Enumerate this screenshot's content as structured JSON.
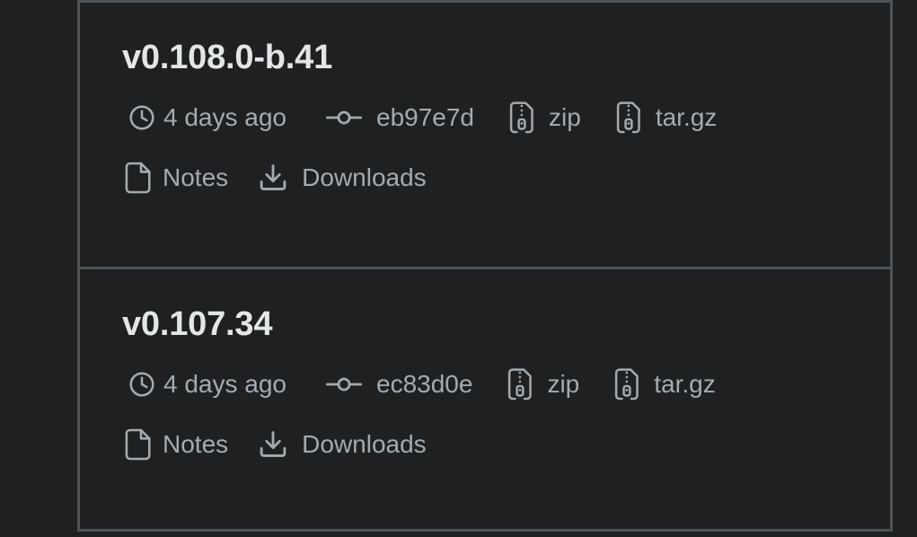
{
  "panel": {
    "name": "releases-list",
    "border_color": "#4d5356",
    "background": "#1f2021",
    "title_color": "#e3e6e8",
    "meta_color": "#a3abb0"
  },
  "releases": [
    {
      "version": "v0.108.0-b.41",
      "time_ago": "4 days ago",
      "commit": "eb97e7d",
      "zip_label": "zip",
      "targz_label": "tar.gz",
      "notes_label": "Notes",
      "downloads_label": "Downloads",
      "icons": {
        "time": "clock-icon",
        "commit": "git-commit-icon",
        "zip": "zip-file-icon",
        "targz": "zip-file-icon",
        "notes": "file-icon",
        "downloads": "download-icon"
      }
    },
    {
      "version": "v0.107.34",
      "time_ago": "4 days ago",
      "commit": "ec83d0e",
      "zip_label": "zip",
      "targz_label": "tar.gz",
      "notes_label": "Notes",
      "downloads_label": "Downloads",
      "icons": {
        "time": "clock-icon",
        "commit": "git-commit-icon",
        "zip": "zip-file-icon",
        "targz": "zip-file-icon",
        "notes": "file-icon",
        "downloads": "download-icon"
      }
    }
  ]
}
